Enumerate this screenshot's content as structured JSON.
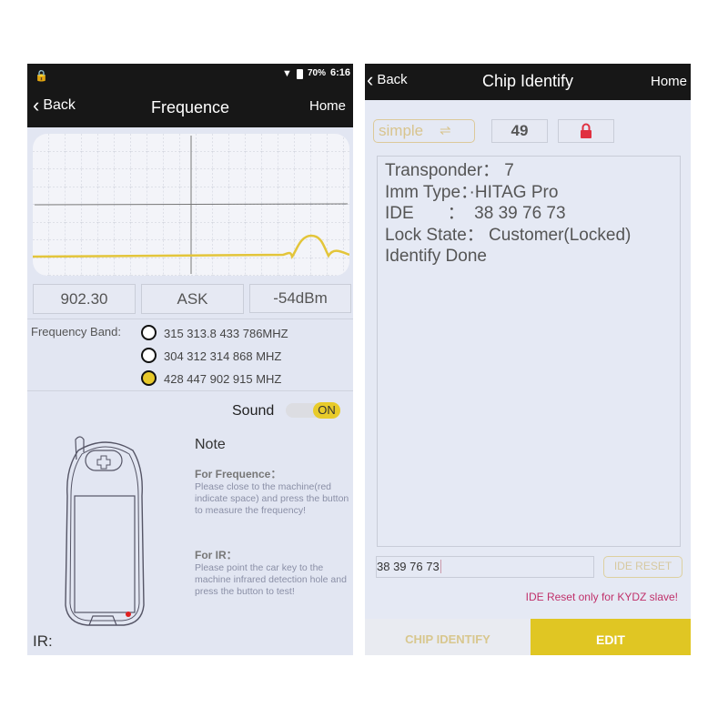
{
  "left": {
    "status": {
      "battery": "70%",
      "time": "6:16",
      "icons": [
        "lock-icon",
        "wifi-icon",
        "battery-icon"
      ]
    },
    "header": {
      "back": "Back",
      "title": "Frequence",
      "home": "Home"
    },
    "readouts": {
      "frequency": "902.30",
      "modulation": "ASK",
      "signal": "-54dBm"
    },
    "band_label": "Frequency Band:",
    "bands": [
      {
        "label": "315 313.8 433 786MHZ",
        "selected": false
      },
      {
        "label": "304 312 314 868 MHZ",
        "selected": false
      },
      {
        "label": "428 447 902 915  MHZ",
        "selected": true
      }
    ],
    "sound": {
      "label": "Sound",
      "state": "ON"
    },
    "note": {
      "title": "Note",
      "freq_heading": "For Frequence：",
      "freq_text": "Please close to the machine(red indicate space) and press the button to measure the frequency!",
      "ir_heading": "For IR：",
      "ir_text": "Please point the car key to the machine infrared detection hole and press the button to test!"
    },
    "ir_label": "IR:"
  },
  "right": {
    "header": {
      "back": "Back",
      "title": "Chip Identify",
      "home": "Home"
    },
    "mode": "simple",
    "mode_icon": "swap-icon",
    "count": "49",
    "lock_icon": "lock-icon",
    "lock_color": "#e03040",
    "info": [
      "Transponder： 7",
      "Imm Type：·HITAG Pro",
      "IDE       ：  38 39 76 73",
      "Lock State： Customer(Locked)",
      "Identify Done"
    ],
    "ide_input": "38 39 76 73",
    "ide_reset": "IDE RESET",
    "warning": "IDE Reset only for KYDZ slave!",
    "tabs": [
      {
        "label": "CHIP IDENTIFY",
        "active": false
      },
      {
        "label": "EDIT",
        "active": true
      }
    ]
  },
  "colors": {
    "accent": "#e0c623",
    "warning": "#c0306a"
  }
}
